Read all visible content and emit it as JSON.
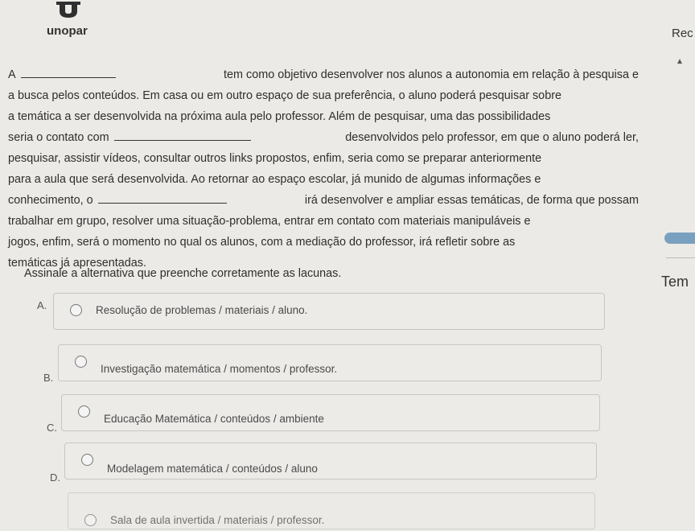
{
  "header": {
    "brand": "unopar",
    "rec_label": "Rec"
  },
  "question": {
    "lines": [
      [
        "A",
        "tem como objetivo desenvolver nos alunos a autonomia em relação à pesquisa e"
      ],
      [
        "a busca pelos conteúdos. Em casa ou em outro espaço de sua preferência, o aluno poderá pesquisar sobre"
      ],
      [
        "a temática a ser desenvolvida na próxima aula pelo professor. Além de pesquisar, uma das possibilidades"
      ],
      [
        "seria o contato com",
        "desenvolvidos pelo professor, em que o aluno poderá ler,"
      ],
      [
        "pesquisar, assistir vídeos, consultar outros links propostos, enfim, seria como se preparar anteriormente"
      ],
      [
        "para a aula que será desenvolvida. Ao retornar ao espaço escolar, já munido de algumas informações e"
      ],
      [
        "conhecimento, o",
        "irá desenvolver e ampliar essas temáticas, de forma que possam"
      ],
      [
        "trabalhar em grupo, resolver uma situação-problema, entrar em contato com materiais manipuláveis e"
      ],
      [
        "jogos, enfim, será o momento no qual os alunos, com a mediação do professor, irá refletir sobre as"
      ],
      [
        "temáticas já apresentadas."
      ]
    ],
    "instruction": "Assinale a alternativa que preenche corretamente as lacunas."
  },
  "side": {
    "tem_label": "Tem"
  },
  "options": [
    {
      "letter": "A.",
      "text": "Resolução de problemas / materiais / aluno."
    },
    {
      "letter": "B.",
      "text": "Investigação matemática / momentos / professor."
    },
    {
      "letter": "C.",
      "text": "Educação Matemática / conteúdos / ambiente"
    },
    {
      "letter": "D.",
      "text": "Modelagem matemática / conteúdos / aluno"
    },
    {
      "letter": "",
      "text": "Sala de aula invertida / materiais / professor."
    }
  ]
}
